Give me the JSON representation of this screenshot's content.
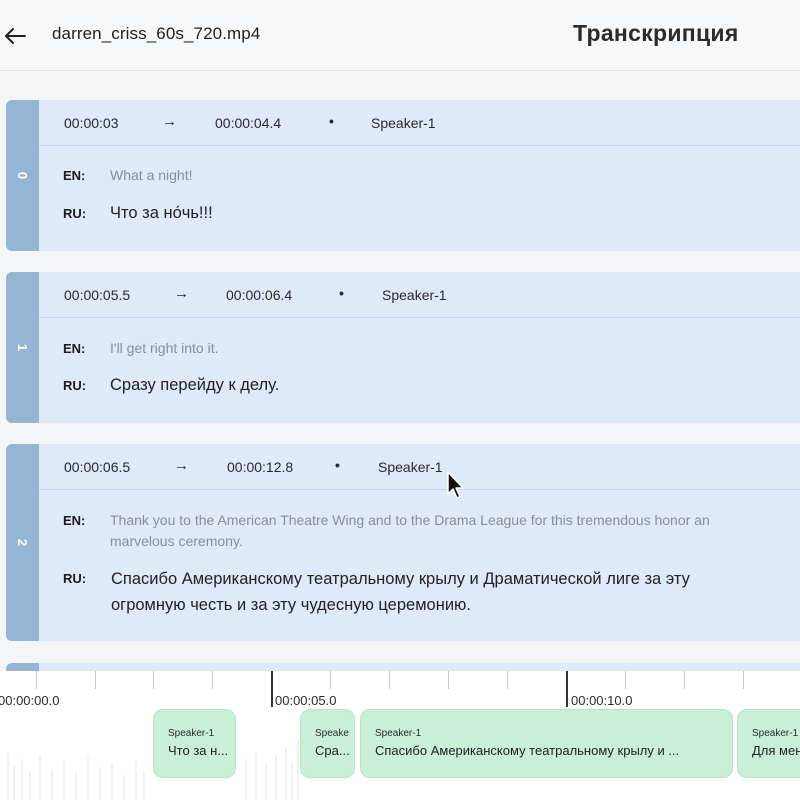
{
  "header": {
    "file_name": "darren_criss_60s_720.mp4",
    "title": "Транскрипция",
    "back_icon": "arrow-left-icon"
  },
  "segments": [
    {
      "index": "0",
      "start": "00:00:03",
      "end": "00:00:04.4",
      "speaker": "Speaker-1",
      "en_label": "EN:",
      "ru_label": "RU:",
      "en": "What a night!",
      "ru": "Что за но́чь!!!"
    },
    {
      "index": "1",
      "start": "00:00:05.5",
      "end": "00:00:06.4",
      "speaker": "Speaker-1",
      "en_label": "EN:",
      "ru_label": "RU:",
      "en": "I'll get right into it.",
      "ru": "Сразу перейду к делу."
    },
    {
      "index": "2",
      "start": "00:00:06.5",
      "end": "00:00:12.8",
      "speaker": "Speaker-1",
      "en_label": "EN:",
      "ru_label": "RU:",
      "en_line1": "Thank you to the American Theatre Wing and to the Drama League for this tremendous honor an",
      "en_line2": "marvelous ceremony.",
      "ru_line1": "Спасибо Американскому театральному крылу и Драматической лиге за эту",
      "ru_line2": "огромную честь и за эту чудесную церемонию."
    }
  ],
  "separators": {
    "arrow": "→",
    "dot": "•"
  },
  "timeline": {
    "tick_labels": [
      "00:00:00.0",
      "00:00:05.0",
      "00:00:10.0"
    ],
    "clips": [
      {
        "speaker": "Speaker-1",
        "text": "Что за н..."
      },
      {
        "speaker": "Speake",
        "text": "Сра..."
      },
      {
        "speaker": "Speaker-1",
        "text": "Спасибо Американскому театральному крылу и ..."
      },
      {
        "speaker": "Speaker-1",
        "text": "Для мен"
      }
    ]
  },
  "colors": {
    "segment_bg": "#dee9fa",
    "segment_strip": "#94b6d3",
    "clip_bg": "#c9efd6"
  }
}
